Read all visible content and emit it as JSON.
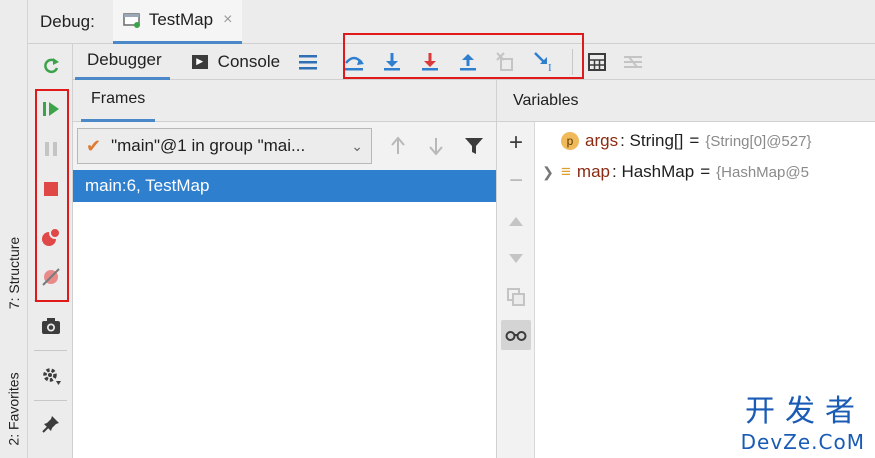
{
  "header": {
    "debug_label": "Debug:",
    "tab_name": "TestMap",
    "tab_close": "×"
  },
  "side_tabs": {
    "structure": "7: Structure",
    "favorites": "2: Favorites"
  },
  "tabs": {
    "debugger": "Debugger",
    "console": "Console"
  },
  "frames": {
    "title": "Frames",
    "thread_selected": "\"main\"@1 in group \"mai...",
    "frame_item": "main:6, TestMap"
  },
  "variables": {
    "title": "Variables",
    "items": [
      {
        "badge": "p",
        "name": "args",
        "type": ": String[]",
        "eq": "=",
        "value": "{String[0]@527}"
      },
      {
        "badge": "≡",
        "name": "map",
        "type": ": HashMap",
        "eq": "=",
        "value": "{HashMap@5"
      }
    ]
  },
  "icons": {
    "rerun": "rerun-icon",
    "resume": "resume-icon",
    "pause": "pause-icon",
    "stop": "stop-icon",
    "view_breakpoints": "view-breakpoints-icon",
    "mute_breakpoints": "mute-breakpoints-icon",
    "camera": "camera-icon",
    "settings": "settings-icon",
    "pin": "pin-icon"
  },
  "colors": {
    "accent_blue": "#2f7fcf",
    "highlight_red": "#e01a1a",
    "resume_green": "#3da34a"
  },
  "watermark": {
    "cn": "开发者",
    "en": "DevZe.CoM"
  }
}
